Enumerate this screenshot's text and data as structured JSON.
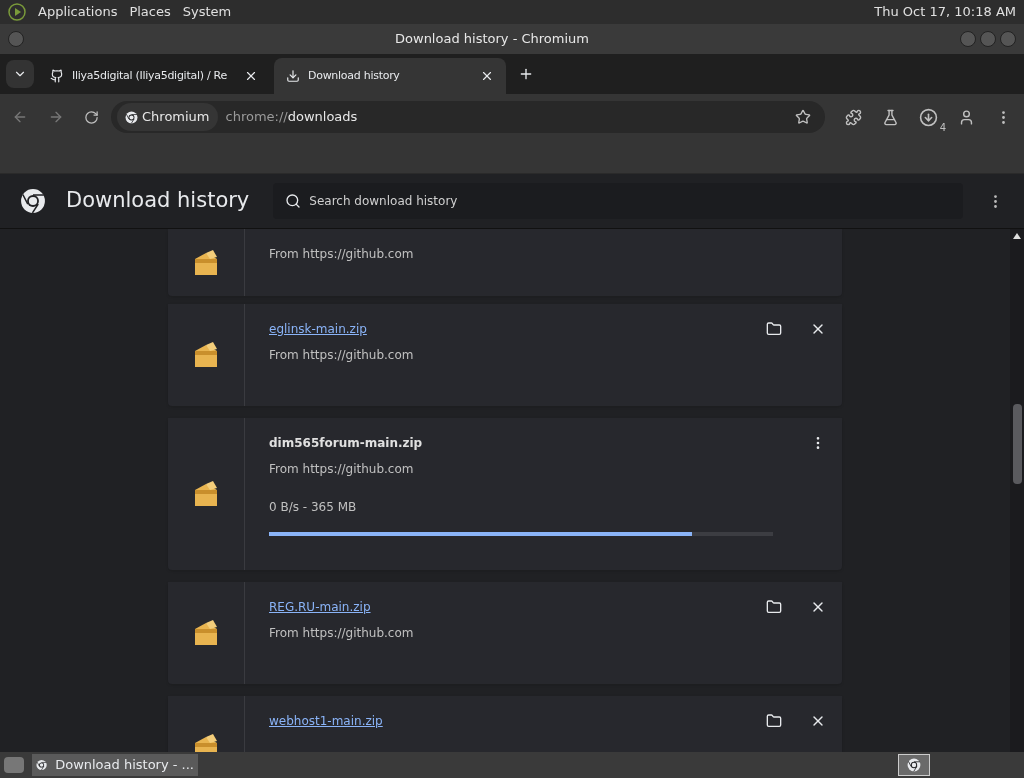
{
  "top_panel": {
    "menus": [
      "Applications",
      "Places",
      "System"
    ],
    "clock": "Thu Oct 17, 10:18 AM"
  },
  "window": {
    "title": "Download history - Chromium"
  },
  "tabs": [
    {
      "title": "Iliya5digital (Iliya5digital) / Re",
      "kind": "github",
      "selected": false
    },
    {
      "title": "Download history",
      "kind": "download",
      "selected": true
    }
  ],
  "toolbar": {
    "site_chip": "Chromium",
    "url_scheme": "chrome://",
    "url_path": "downloads",
    "download_count": "4"
  },
  "page": {
    "title": "Download history",
    "search": {
      "placeholder": "Search download history"
    }
  },
  "downloads": [
    {
      "kind": "complete",
      "from": "From https://github.com"
    },
    {
      "kind": "complete",
      "name": "eglinsk-main.zip",
      "from": "From https://github.com"
    },
    {
      "kind": "in_progress",
      "name": "dim565forum-main.zip",
      "from": "From https://github.com",
      "status": "0 B/s - 365 MB",
      "level": 0.84
    },
    {
      "kind": "complete",
      "name": "REG.RU-main.zip",
      "from": "From https://github.com"
    },
    {
      "kind": "complete",
      "name": "webhost1-main.zip"
    }
  ],
  "taskbar": {
    "windows": [
      {
        "title": "Download history - ...",
        "selected": true
      }
    ]
  }
}
